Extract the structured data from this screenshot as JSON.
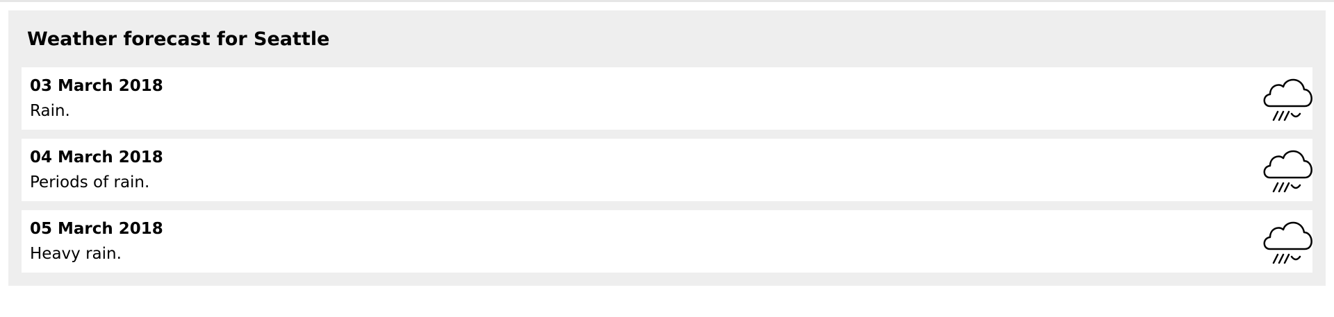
{
  "page": {
    "title": "Weather forecast for Seattle"
  },
  "forecast": [
    {
      "date": "03 March 2018",
      "description": "Rain.",
      "icon": "rain-cloud-icon"
    },
    {
      "date": "04 March 2018",
      "description": "Periods of rain.",
      "icon": "rain-cloud-icon"
    },
    {
      "date": "05 March 2018",
      "description": "Heavy rain.",
      "icon": "rain-cloud-icon"
    }
  ],
  "colors": {
    "panel_background": "#eeeeee",
    "card_background": "#ffffff",
    "text": "#000000"
  }
}
